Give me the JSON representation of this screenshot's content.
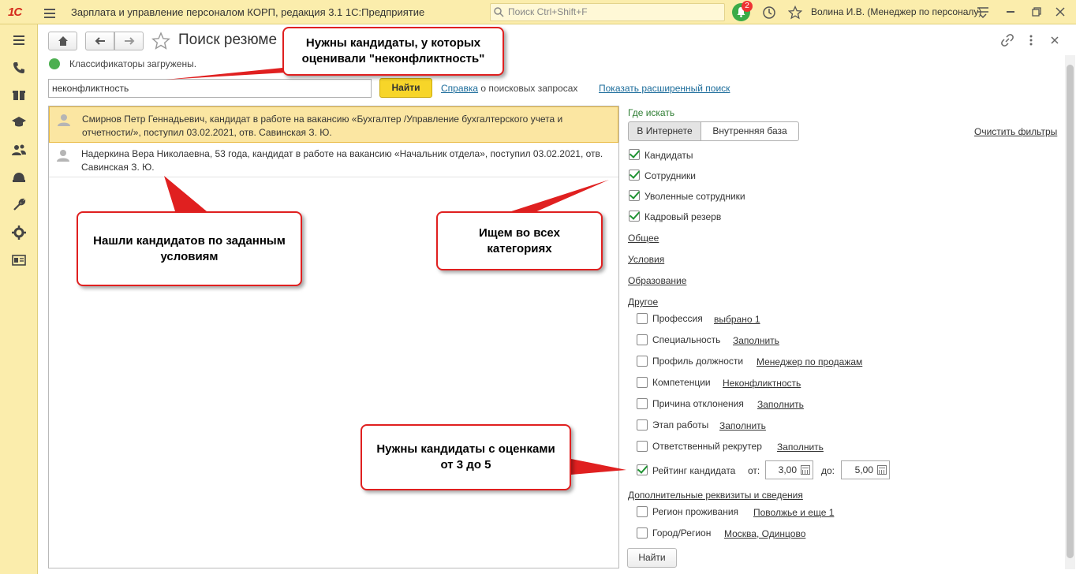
{
  "app": {
    "logo": "1С",
    "title": "Зарплата и управление персоналом КОРП, редакция 3.1 1С:Предприятие",
    "search_placeholder": "Поиск Ctrl+Shift+F",
    "notifications_count": "2",
    "user": "Волина И.В. (Менеджер по персоналу)"
  },
  "page": {
    "title": "Поиск резюме",
    "status": "Классификаторы загружены.",
    "query": "неконфликтность",
    "find_label": "Найти",
    "help_link": "Справка",
    "help_suffix": "о поисковых запросах",
    "advanced_link": "Показать расширенный поиск"
  },
  "results": [
    {
      "text": "Смирнов Петр Геннадьевич, кандидат в работе на вакансию «Бухгалтер /Управление бухгалтерского учета и отчетности/», поступил 03.02.2021, отв. Савинская З. Ю."
    },
    {
      "text": "Надеркина Вера Николаевна, 53 года, кандидат в работе на вакансию «Начальник отдела», поступил 03.02.2021, отв. Савинская З. Ю."
    }
  ],
  "filters": {
    "where_title": "Где искать",
    "seg_internet": "В Интернете",
    "seg_internal": "Внутренняя база",
    "clear": "Очистить фильтры",
    "categories": [
      {
        "label": "Кандидаты",
        "checked": true
      },
      {
        "label": "Сотрудники",
        "checked": true
      },
      {
        "label": "Уволенные сотрудники",
        "checked": true
      },
      {
        "label": "Кадровый резерв",
        "checked": true
      }
    ],
    "section_general": "Общее",
    "section_conditions": "Условия",
    "section_education": "Образование",
    "section_other": "Другое",
    "other_items": [
      {
        "label": "Профессия",
        "value": "выбрано 1"
      },
      {
        "label": "Специальность",
        "value": "Заполнить"
      },
      {
        "label": "Профиль должности",
        "value": "Менеджер по продажам"
      },
      {
        "label": "Компетенции",
        "value": "Неконфликтность"
      },
      {
        "label": "Причина отклонения",
        "value": "Заполнить"
      },
      {
        "label": "Этап работы",
        "value": "Заполнить"
      },
      {
        "label": "Ответственный рекрутер",
        "value": "Заполнить"
      }
    ],
    "rating": {
      "label": "Рейтинг кандидата",
      "from_label": "от:",
      "from": "3,00",
      "to_label": "до:",
      "to": "5,00",
      "checked": true
    },
    "section_extra": "Дополнительные реквизиты и сведения",
    "extra_items": [
      {
        "label": "Регион проживания",
        "value": "Поволжье и еще 1"
      },
      {
        "label": "Город/Регион",
        "value": "Москва, Одинцово"
      }
    ],
    "find_bottom": "Найти"
  },
  "callouts": {
    "top": "Нужны кандидаты, у которых оценивали \"неконфликтность\"",
    "found": "Нашли кандидатов по заданным условиям",
    "all_categories": "Ищем во всех категориях",
    "rating": "Нужны кандидаты с оценками от 3 до 5"
  }
}
